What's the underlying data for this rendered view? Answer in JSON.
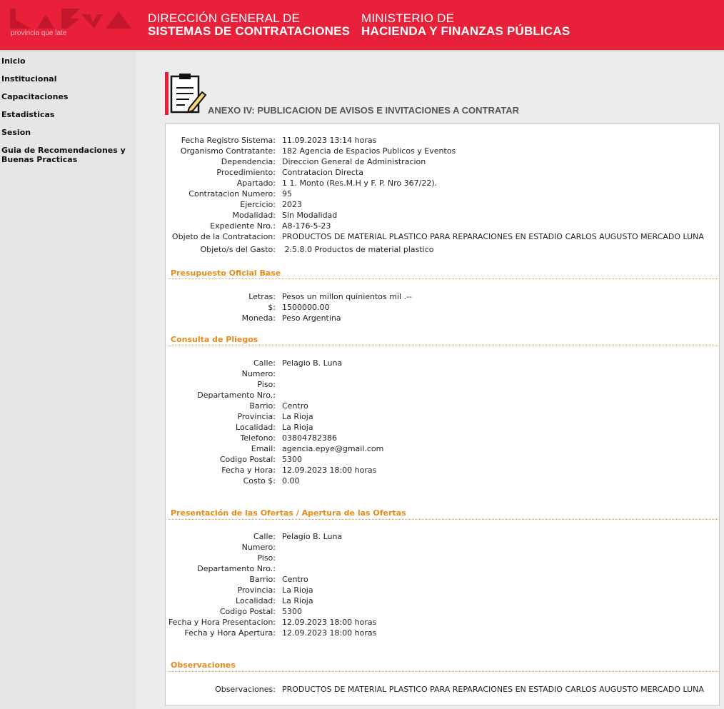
{
  "header": {
    "logo_text": "provincia que late",
    "dept_line1": "DIRECCIÓN GENERAL DE",
    "dept_line2": "SISTEMAS DE CONTRATACIONES",
    "min_line1": "MINISTERIO DE",
    "min_line2": "HACIENDA Y FINANZAS PÚBLICAS",
    "brand_color": "#e8203a"
  },
  "nav": {
    "items": [
      "Inicio",
      "Institucional",
      "Capacitaciones",
      "Estadisticas",
      "Sesion",
      "Guia de Recomendaciones y",
      "Buenas Practicas"
    ]
  },
  "page": {
    "title": "ANEXO IV: PUBLICACION DE AVISOS E INVITACIONES A CONTRATAR",
    "icon": "clipboard-pencil-icon"
  },
  "general": [
    {
      "label": "Fecha Registro Sistema:",
      "value": "11.09.2023 13:14 horas"
    },
    {
      "label": "Organismo Contratante:",
      "value": "182 Agencia de Espacios Publicos y Eventos"
    },
    {
      "label": "Dependencia:",
      "value": "Direccion General de Administracion"
    },
    {
      "label": "Procedimiento:",
      "value": "Contratacion Directa"
    },
    {
      "label": "Apartado:",
      "value": "1 1. Monto (Res.M.H y F. P. Nro 367/22)."
    },
    {
      "label": "Contratacion Numero:",
      "value": "95"
    },
    {
      "label": "Ejercicio:",
      "value": "2023"
    },
    {
      "label": "Modalidad:",
      "value": "Sin Modalidad"
    },
    {
      "label": "Expediente Nro.:",
      "value": "A8-176-5-23"
    },
    {
      "label": "Objeto de la Contratacion:",
      "value": "PRODUCTOS DE MATERIAL PLASTICO PARA REPARACIONES EN ESTADIO CARLOS AUGUSTO MERCADO LUNA"
    },
    {
      "label": "Objeto/s del Gasto:",
      "value": " 2.5.8.0 Productos de material plastico"
    }
  ],
  "presupuesto": {
    "heading": "Presupuesto Oficial Base",
    "rows": [
      {
        "label": "Letras:",
        "value": "Pesos un millon quinientos mil .--"
      },
      {
        "label": "$:",
        "value": "1500000.00"
      },
      {
        "label": "Moneda:",
        "value": "Peso Argentina"
      }
    ]
  },
  "pliegos": {
    "heading": "Consulta de Pliegos",
    "rows": [
      {
        "label": "Calle:",
        "value": "Pelagio B. Luna"
      },
      {
        "label": "Numero:",
        "value": ""
      },
      {
        "label": "Piso:",
        "value": ""
      },
      {
        "label": "Departamento Nro.:",
        "value": ""
      },
      {
        "label": "Barrio:",
        "value": "Centro"
      },
      {
        "label": "Provincia:",
        "value": "La Rioja"
      },
      {
        "label": "Localidad:",
        "value": "La Rioja"
      },
      {
        "label": "Telefono:",
        "value": "03804782386"
      },
      {
        "label": "Email:",
        "value": "agencia.epye@gmail.com"
      },
      {
        "label": "Codigo Postal:",
        "value": "5300"
      },
      {
        "label": "Fecha y Hora:",
        "value": "12.09.2023 18:00 horas"
      },
      {
        "label": "Costo $:",
        "value": "0.00"
      }
    ]
  },
  "ofertas": {
    "heading": "Presentación de las Ofertas / Apertura de las Ofertas",
    "rows": [
      {
        "label": "Calle:",
        "value": "Pelagio B. Luna"
      },
      {
        "label": "Numero:",
        "value": ""
      },
      {
        "label": "Piso:",
        "value": ""
      },
      {
        "label": "Departamento Nro.:",
        "value": ""
      },
      {
        "label": "Barrio:",
        "value": "Centro"
      },
      {
        "label": "Provincia:",
        "value": "La Rioja"
      },
      {
        "label": "Localidad:",
        "value": "La Rioja"
      },
      {
        "label": "Codigo Postal:",
        "value": "5300"
      },
      {
        "label": "Fecha y Hora Presentacion:",
        "value": "12.09.2023 18:00 horas"
      },
      {
        "label": "Fecha y Hora Apertura:",
        "value": "12.09.2023 18:00 horas"
      }
    ]
  },
  "observaciones": {
    "heading": "Observaciones",
    "rows": [
      {
        "label": "Observaciones:",
        "value": "PRODUCTOS DE MATERIAL PLASTICO PARA REPARACIONES EN ESTADIO CARLOS AUGUSTO MERCADO LUNA"
      }
    ]
  }
}
